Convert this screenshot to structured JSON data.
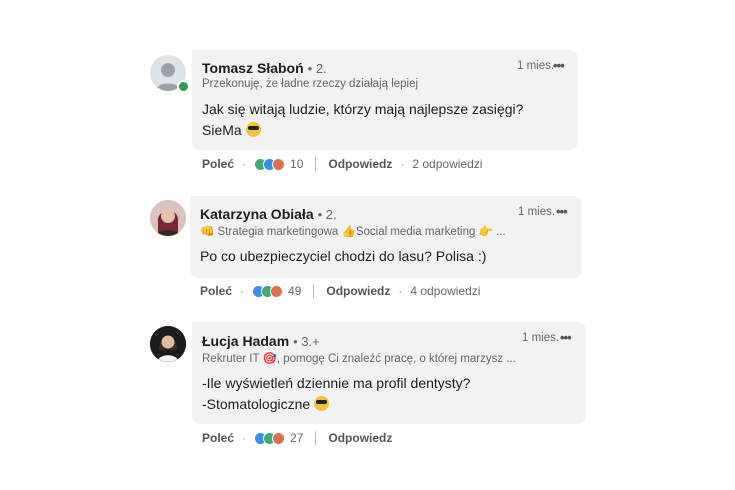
{
  "comments": [
    {
      "name": "Tomasz Słaboń",
      "degree": "• 2.",
      "headline": "Przekonuję, że ładne rzeczy działają lepiej",
      "time": "1 mies.",
      "more": "•••",
      "lines": [
        "Jak się witają ludzie, którzy mają najlepsze zasięgi?",
        "SieMa"
      ],
      "like_label": "Poleć",
      "reaction_count": "10",
      "reply_label": "Odpowiedz",
      "replies_label": "2 odpowiedzi"
    },
    {
      "name": "Katarzyna Obiała",
      "degree": "• 2.",
      "headline": "👊 Strategia marketingowa 👍Social media marketing 👉 ...",
      "time": "1 mies.",
      "more": "•••",
      "lines": [
        "Po co ubezpieczyciel chodzi do lasu? Polisa :)"
      ],
      "like_label": "Poleć",
      "reaction_count": "49",
      "reply_label": "Odpowiedz",
      "replies_label": "4 odpowiedzi"
    },
    {
      "name": "Łucja Hadam",
      "degree": "• 3.+",
      "headline": "Rekruter IT 🎯, pomogę Ci znaleźć pracę, o której marzysz ...",
      "time": "1 mies.",
      "more": "•••",
      "lines": [
        "-Ile wyświetleń dziennie ma profil dentysty?",
        "-Stomatologiczne"
      ],
      "like_label": "Poleć",
      "reaction_count": "27",
      "reply_label": "Odpowiedz"
    }
  ],
  "emoji": "sunglasses-emoji",
  "colors": {
    "bubble": "#f2f2f2",
    "online": "#2e9c4e",
    "like_blue": "#378fe9"
  }
}
